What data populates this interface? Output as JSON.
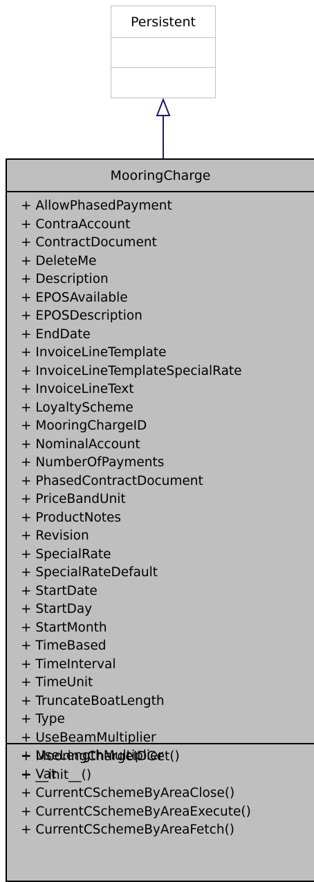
{
  "parent_class": {
    "name": "Persistent"
  },
  "main_class": {
    "name": "MooringCharge",
    "attributes": [
      "+ AllowPhasedPayment",
      "+ ContraAccount",
      "+ ContractDocument",
      "+ DeleteMe",
      "+ Description",
      "+ EPOSAvailable",
      "+ EPOSDescription",
      "+ EndDate",
      "+ InvoiceLineTemplate",
      "+ InvoiceLineTemplateSpecialRate",
      "+ InvoiceLineText",
      "+ LoyaltyScheme",
      "+ MooringChargeID",
      "+ NominalAccount",
      "+ NumberOfPayments",
      "+ PhasedContractDocument",
      "+ PriceBandUnit",
      "+ ProductNotes",
      "+ Revision",
      "+ SpecialRate",
      "+ SpecialRateDefault",
      "+ StartDate",
      "+ StartDay",
      "+ StartMonth",
      "+ TimeBased",
      "+ TimeInterval",
      "+ TimeUnit",
      "+ TruncateBoatLength",
      "+ Type",
      "+ UseBeamMultiplier",
      "+ UseLengthMultiplier",
      "+ Vat"
    ],
    "operations": [
      "+ MooringChargeIDGet()",
      "+ __init__()",
      "+ CurrentCSchemeByAreaClose()",
      "+ CurrentCSchemeByAreaExecute()",
      "+ CurrentCSchemeByAreaFetch()"
    ]
  },
  "colors": {
    "class_fill": "#bfbfbf",
    "parent_border": "#bfbfbf",
    "inheritance_arrow": "#191970"
  }
}
